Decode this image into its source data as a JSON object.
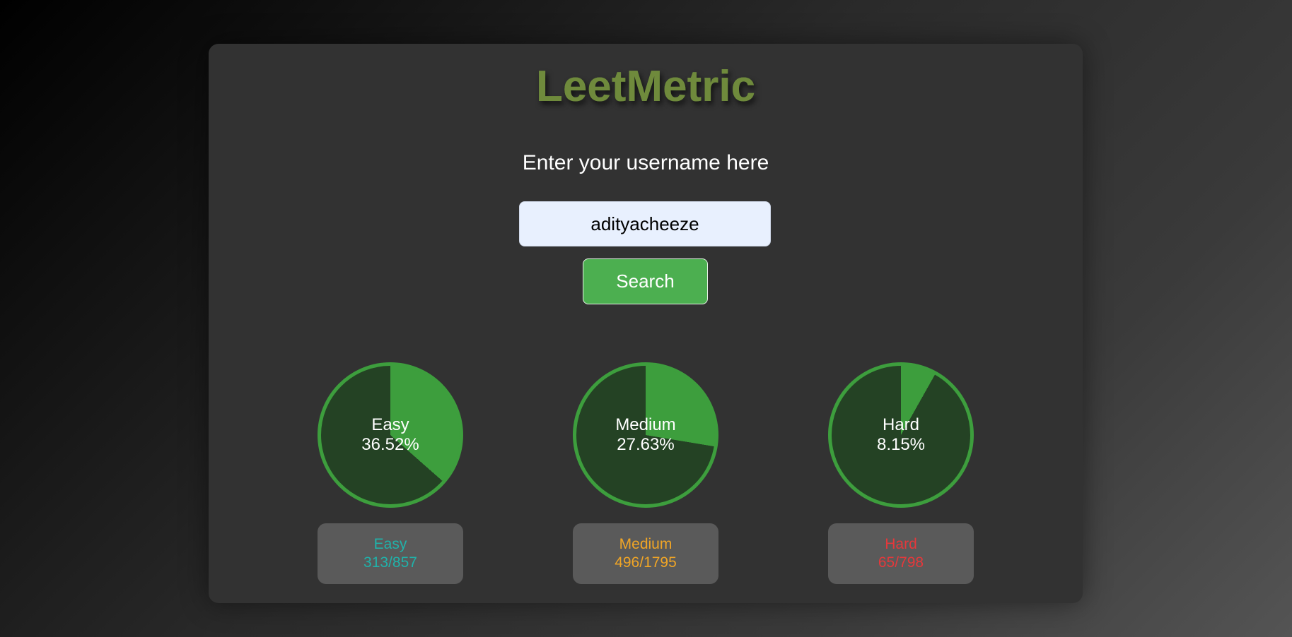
{
  "app": {
    "title": "LeetMetric"
  },
  "search": {
    "prompt": "Enter your username here",
    "value": "adityacheeze",
    "button_label": "Search"
  },
  "progress": [
    {
      "label": "Easy",
      "percent_text": "36.52%",
      "percent": 36.52
    },
    {
      "label": "Medium",
      "percent_text": "27.63%",
      "percent": 27.63
    },
    {
      "label": "Hard",
      "percent_text": "8.15%",
      "percent": 8.15
    }
  ],
  "stats": [
    {
      "label": "Easy",
      "value": "313/857",
      "color": "#20b2aa"
    },
    {
      "label": "Medium",
      "value": "496/1795",
      "color": "#f0a526"
    },
    {
      "label": "Hard",
      "value": "65/798",
      "color": "#e5383b"
    }
  ],
  "colors": {
    "progress_fill": "#3d9e3d",
    "progress_track": "#244224",
    "button": "#4caf50"
  }
}
